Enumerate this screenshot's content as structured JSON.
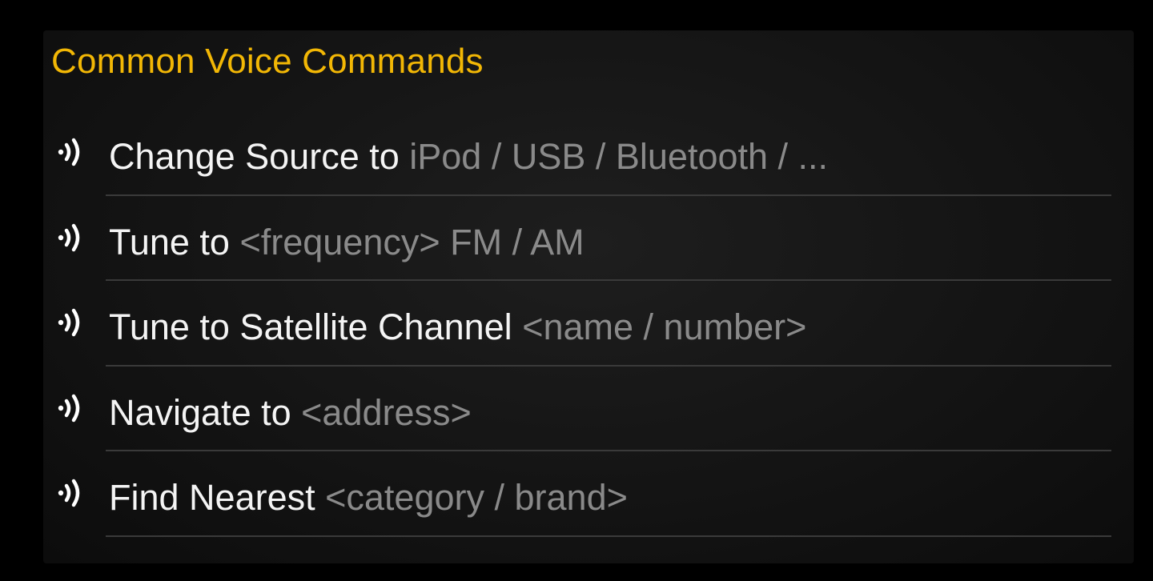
{
  "panel": {
    "title": "Common Voice Commands",
    "title_color": "#f2b705"
  },
  "commands": [
    {
      "phrase": "Change Source to",
      "param": "iPod / USB / Bluetooth / ...",
      "icon": "voice-command-icon"
    },
    {
      "phrase": "Tune to",
      "param": "<frequency> FM / AM",
      "icon": "voice-command-icon"
    },
    {
      "phrase": "Tune to Satellite Channel",
      "param": "<name / number>",
      "icon": "voice-command-icon"
    },
    {
      "phrase": "Navigate to",
      "param": "<address>",
      "icon": "voice-command-icon"
    },
    {
      "phrase": "Find Nearest",
      "param": "<category / brand>",
      "icon": "voice-command-icon"
    }
  ],
  "colors": {
    "background": "#000000",
    "phrase_text": "#f4f4f4",
    "param_text": "#8a8a8a",
    "divider": "#3a3a3a"
  }
}
